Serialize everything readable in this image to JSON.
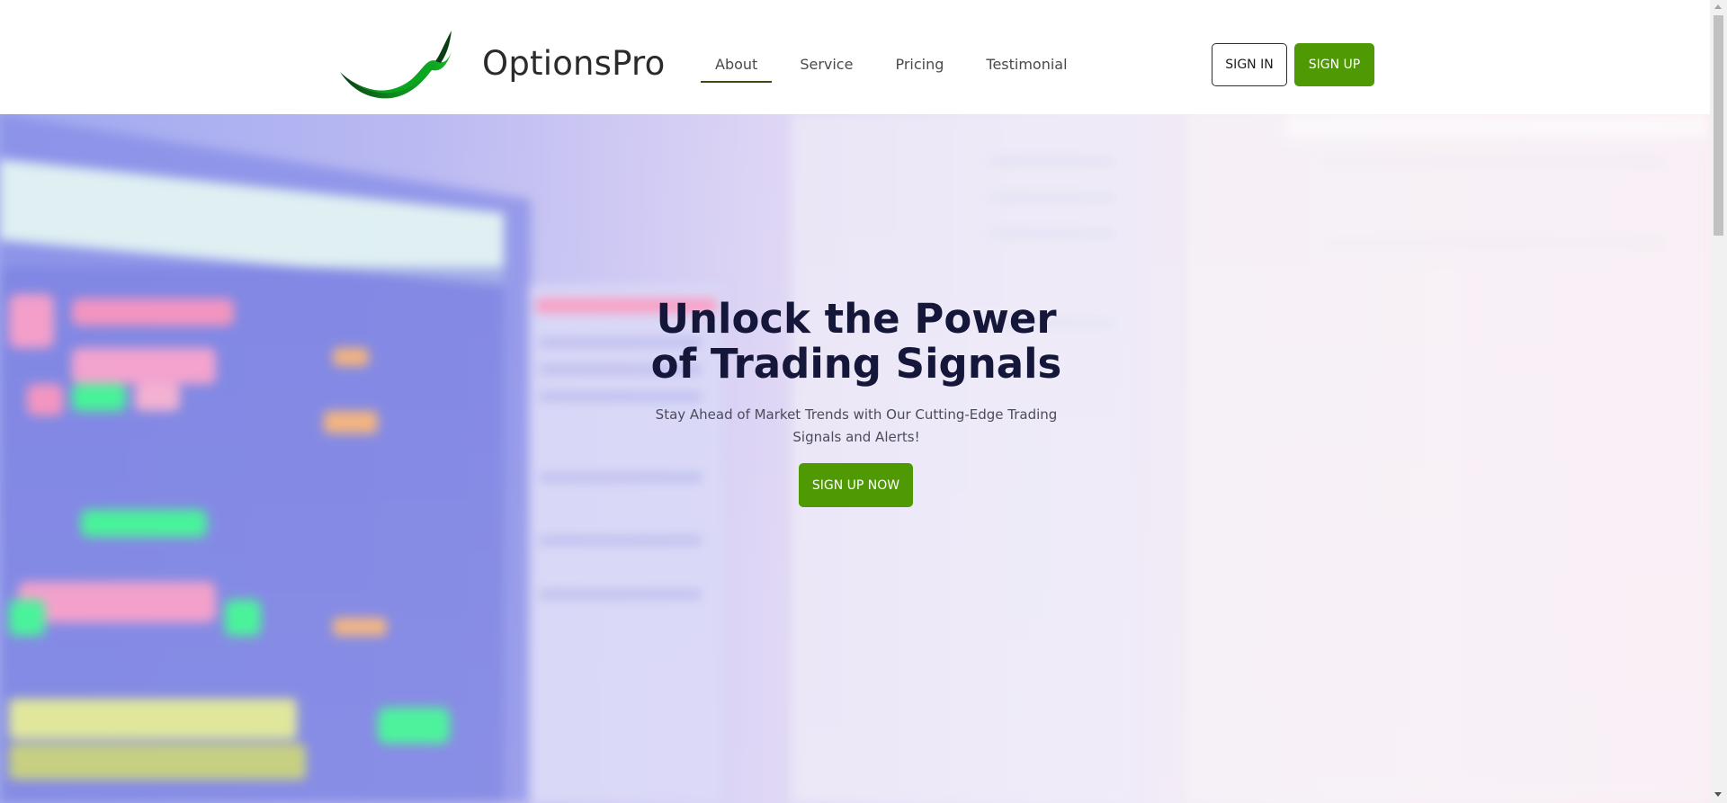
{
  "brand": {
    "name": "OptionsPro",
    "logo_icon": "green-swoosh-logo"
  },
  "nav": {
    "items": [
      {
        "label": "About",
        "active": true
      },
      {
        "label": "Service",
        "active": false
      },
      {
        "label": "Pricing",
        "active": false
      },
      {
        "label": "Testimonial",
        "active": false
      }
    ]
  },
  "auth": {
    "signin_label": "SIGN IN",
    "signup_label": "SIGN UP"
  },
  "hero": {
    "title_line1": "Unlock the Power",
    "title_line2": "of Trading Signals",
    "subtitle": "Stay Ahead of Market Trends with Our Cutting-Edge Trading Signals and Alerts!",
    "cta_label": "SIGN UP NOW",
    "background": "blurred-trading-monitors-image"
  },
  "colors": {
    "accent_green": "#4f9905",
    "title_navy": "#14163a",
    "nav_underline": "#3e4a14"
  }
}
